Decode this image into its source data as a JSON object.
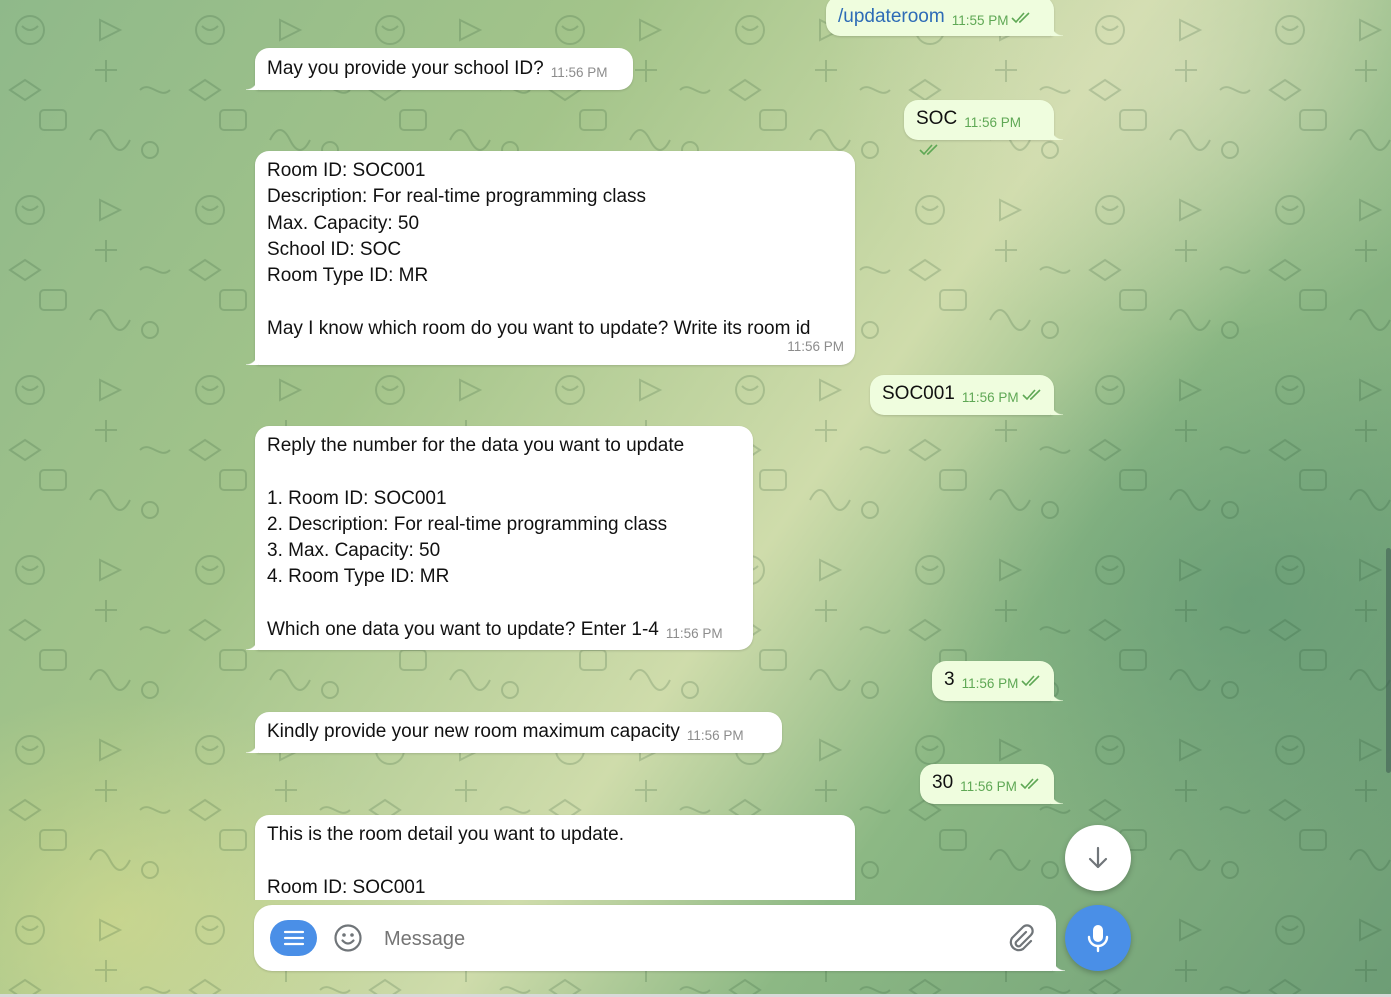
{
  "chat": {
    "messages": [
      {
        "id": "m1",
        "direction": "outgoing",
        "lines": [
          "/updateroom"
        ],
        "time": "11:55 PM"
      },
      {
        "id": "m2",
        "direction": "incoming",
        "lines": [
          "May you provide your school ID?"
        ],
        "time": "11:56 PM"
      },
      {
        "id": "m3",
        "direction": "outgoing",
        "lines": [
          "SOC"
        ],
        "time": "11:56 PM"
      },
      {
        "id": "m4",
        "direction": "incoming",
        "lines": [
          "Room ID: SOC001",
          "Description: For real-time programming class",
          "Max. Capacity: 50",
          "School ID: SOC",
          "Room Type ID: MR",
          "",
          "May I know which room do you want to update? Write its room id"
        ],
        "time": "11:56 PM"
      },
      {
        "id": "m5",
        "direction": "outgoing",
        "lines": [
          "SOC001"
        ],
        "time": "11:56 PM"
      },
      {
        "id": "m6",
        "direction": "incoming",
        "lines": [
          "Reply the number for the data you want to update",
          "",
          "1. Room ID: SOC001",
          "2. Description: For real-time programming class",
          "3. Max. Capacity: 50",
          "4. Room Type ID: MR",
          "",
          "Which one data you want to update? Enter 1-4"
        ],
        "time": "11:56 PM"
      },
      {
        "id": "m7",
        "direction": "outgoing",
        "lines": [
          "3"
        ],
        "time": "11:56 PM"
      },
      {
        "id": "m8",
        "direction": "incoming",
        "lines": [
          "Kindly provide your new room maximum capacity"
        ],
        "time": "11:56 PM"
      },
      {
        "id": "m9",
        "direction": "outgoing",
        "lines": [
          "30"
        ],
        "time": "11:56 PM"
      },
      {
        "id": "m10",
        "direction": "incoming",
        "lines": [
          "This is the room detail you want to update.",
          "",
          "Room ID: SOC001"
        ],
        "time": ""
      }
    ]
  },
  "composer": {
    "placeholder": "Message",
    "menu_icon": "menu-icon",
    "emoji_icon": "emoji-icon",
    "attach_icon": "paperclip-icon",
    "mic_icon": "microphone-icon"
  },
  "scroll_down_icon": "arrow-down-icon",
  "colors": {
    "incoming_bubble": "#ffffff",
    "outgoing_bubble": "#effdde",
    "outgoing_time": "#5fa855",
    "accent": "#4a8fe7",
    "command_link": "#2d6bb6"
  }
}
